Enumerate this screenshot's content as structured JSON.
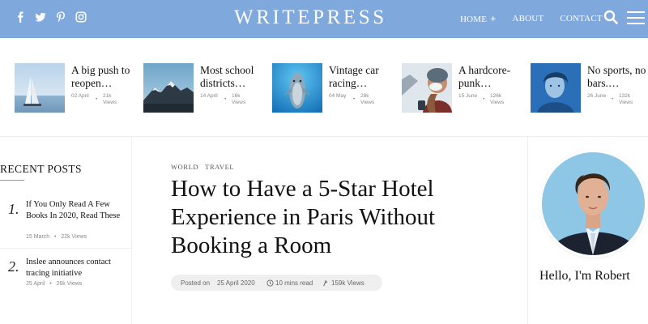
{
  "header": {
    "logo": "WRITEPRESS",
    "social_icons": [
      "facebook-icon",
      "twitter-icon",
      "pinterest-icon",
      "instagram-icon"
    ],
    "nav": [
      {
        "label": "HOME",
        "has_submenu": true,
        "submenu_indicator": "+"
      },
      {
        "label": "ABOUT"
      },
      {
        "label": "CONTACT"
      }
    ],
    "colors": {
      "bar": "#7fa8dc",
      "text": "#ffffff"
    }
  },
  "featured": [
    {
      "title": "A big push to reopen…",
      "date": "02 April",
      "views": "21k Views",
      "image": "sailboat-on-water"
    },
    {
      "title": "Most school districts…",
      "date": "14 April",
      "views": "16k Views",
      "image": "snowy-mountains"
    },
    {
      "title": "Vintage car racing…",
      "date": "04 May",
      "views": "28k Views",
      "image": "dolphin-underwater"
    },
    {
      "title": "A hardcore-punk…",
      "date": "15 June",
      "views": "126k Views",
      "image": "woman-in-mask-snow"
    },
    {
      "title": "No sports, no bars.…",
      "date": "26 June",
      "views": "132k Views",
      "image": "boy-portrait-blue"
    }
  ],
  "recent": {
    "heading": "RECENT POSTS",
    "posts": [
      {
        "number": "1.",
        "title": "If You Only Read A Few Books In 2020, Read These",
        "date": "15 March",
        "views": "22k Views"
      },
      {
        "number": "2.",
        "title": "Inslee announces contact tracing initiative",
        "date": "25 April",
        "views": "26k Views"
      }
    ]
  },
  "article": {
    "categories": [
      "WORLD",
      "TRAVEL"
    ],
    "title": "How to Have a 5-Star Hotel Experience in Paris Without Booking a Room",
    "posted_label": "Posted on",
    "date": "25 April 2020",
    "read_time": "10 mins read",
    "views": "159k Views"
  },
  "author": {
    "greeting": "Hello, I'm Robert"
  }
}
